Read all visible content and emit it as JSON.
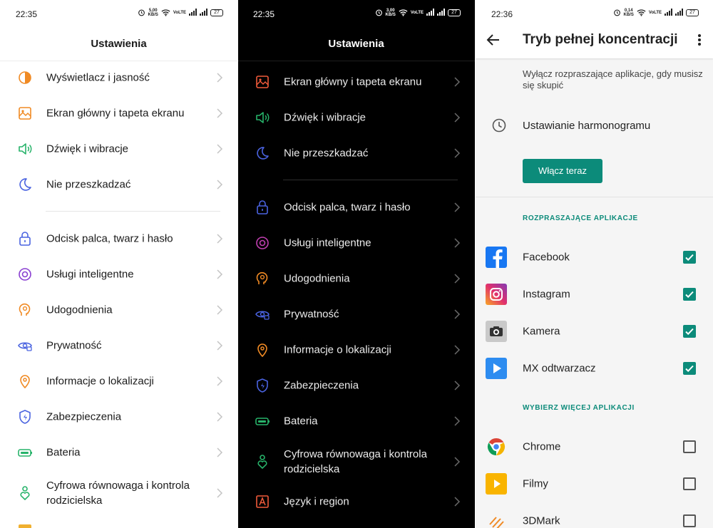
{
  "panel1": {
    "status": {
      "time": "22:35",
      "speed_value": "5,00",
      "speed_unit": "KB/S",
      "volte": "VoLTE",
      "battery": "27"
    },
    "title": "Ustawienia",
    "items": [
      {
        "label": "Wyświetlacz i jasność",
        "icon": "brightness-icon"
      },
      {
        "label": "Ekran główny i tapeta ekranu",
        "icon": "wallpaper-icon"
      },
      {
        "label": "Dźwięk i wibracje",
        "icon": "speaker-icon"
      },
      {
        "label": "Nie przeszkadzać",
        "icon": "moon-icon"
      },
      {
        "label": "Odcisk palca, twarz i hasło",
        "icon": "lock-icon"
      },
      {
        "label": "Usługi inteligentne",
        "icon": "target-icon"
      },
      {
        "label": "Udogodnienia",
        "icon": "head-icon"
      },
      {
        "label": "Prywatność",
        "icon": "eye-icon"
      },
      {
        "label": "Informacje o lokalizacji",
        "icon": "location-pin-icon"
      },
      {
        "label": "Zabezpieczenia",
        "icon": "shield-icon"
      },
      {
        "label": "Bateria",
        "icon": "battery-icon"
      },
      {
        "label": "Cyfrowa równowaga i kontrola rodzicielska",
        "icon": "heart-person-icon"
      }
    ]
  },
  "panel2": {
    "status": {
      "time": "22:35",
      "speed_value": "3,00",
      "speed_unit": "KB/S",
      "volte": "VoLTE",
      "battery": "27"
    },
    "title": "Ustawienia",
    "items": [
      {
        "label": "Ekran główny i tapeta ekranu",
        "icon": "wallpaper-icon"
      },
      {
        "label": "Dźwięk i wibracje",
        "icon": "speaker-icon"
      },
      {
        "label": "Nie przeszkadzać",
        "icon": "moon-icon"
      },
      {
        "label": "Odcisk palca, twarz i hasło",
        "icon": "lock-icon"
      },
      {
        "label": "Usługi inteligentne",
        "icon": "target-icon"
      },
      {
        "label": "Udogodnienia",
        "icon": "head-icon"
      },
      {
        "label": "Prywatność",
        "icon": "eye-icon"
      },
      {
        "label": "Informacje o lokalizacji",
        "icon": "location-pin-icon"
      },
      {
        "label": "Zabezpieczenia",
        "icon": "shield-icon"
      },
      {
        "label": "Bateria",
        "icon": "battery-icon"
      },
      {
        "label": "Cyfrowa równowaga i kontrola rodzicielska",
        "icon": "heart-person-icon"
      },
      {
        "label": "Język i region",
        "icon": "language-icon"
      }
    ]
  },
  "panel3": {
    "status": {
      "time": "22:36",
      "speed_value": "0,14",
      "speed_unit": "KB/S",
      "volte": "VoLTE",
      "battery": "27"
    },
    "title": "Tryb pełnej koncentracji",
    "description": "Wyłącz rozpraszające aplikacje, gdy musisz się skupić",
    "schedule_label": "Ustawianie harmonogramu",
    "enable_button": "Włącz teraz",
    "section_distracting": "ROZPRASZAJĄCE APLIKACJE",
    "distracting_apps": [
      {
        "label": "Facebook",
        "checked": true
      },
      {
        "label": "Instagram",
        "checked": true
      },
      {
        "label": "Kamera",
        "checked": true
      },
      {
        "label": "MX odtwarzacz",
        "checked": true
      }
    ],
    "section_more": "WYBIERZ WIĘCEJ APLIKACJI",
    "more_apps": [
      {
        "label": "Chrome",
        "checked": false
      },
      {
        "label": "Filmy",
        "checked": false
      },
      {
        "label": "3DMark",
        "checked": false
      }
    ]
  },
  "colors": {
    "accent": "#0c8b7a",
    "orange": "#f08a24",
    "green": "#27b36a",
    "blue": "#4a63e0",
    "purple": "#8a3fd1"
  }
}
